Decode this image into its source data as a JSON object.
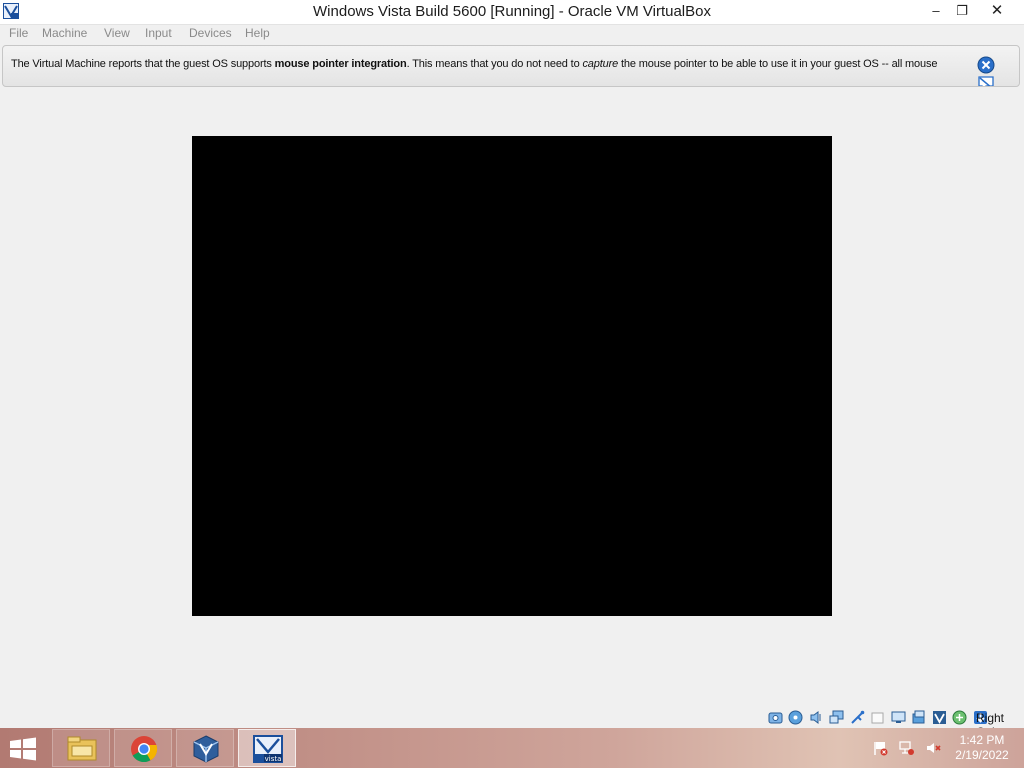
{
  "window": {
    "title": "Windows Vista Build 5600 [Running] - Oracle VM VirtualBox",
    "minimize_glyph": "–",
    "restore_glyph": "❐",
    "close_glyph": "✕"
  },
  "menu": {
    "items": [
      {
        "label": "File"
      },
      {
        "label": "Machine"
      },
      {
        "label": "View"
      },
      {
        "label": "Input"
      },
      {
        "label": "Devices"
      },
      {
        "label": "Help"
      }
    ]
  },
  "notification": {
    "text_part1": "The Virtual Machine reports that the guest OS supports ",
    "text_bold": "mouse pointer integration",
    "text_part2": ". This means that you do not need to ",
    "text_italic": "capture",
    "text_part3": " the mouse pointer to be able to use it in your guest OS -- all mouse",
    "close_icon": "close-icon",
    "dont_show_icon": "do-not-show-again-icon"
  },
  "guest_screen": {
    "background": "#000000"
  },
  "statusbar": {
    "icons": [
      "hard-disk-icon",
      "optical-drive-icon",
      "audio-icon",
      "network-icon",
      "usb-icon",
      "shared-folders-icon",
      "display-icon",
      "video-capture-icon",
      "vt-x-icon",
      "mouse-integration-icon",
      "host-key-icon"
    ],
    "host_key": "Right Ctrl"
  },
  "taskbar": {
    "items": [
      {
        "name": "file-explorer"
      },
      {
        "name": "chrome"
      },
      {
        "name": "virtualbox-manager"
      },
      {
        "name": "vista-vm",
        "active": true
      }
    ],
    "tray": [
      "action-center-flag-icon",
      "network-icon",
      "volume-muted-icon"
    ],
    "time": "1:42 PM",
    "date": "2/19/2022"
  },
  "colors": {
    "accent": "#2a6fc9",
    "taskbar": "#c3938a"
  }
}
